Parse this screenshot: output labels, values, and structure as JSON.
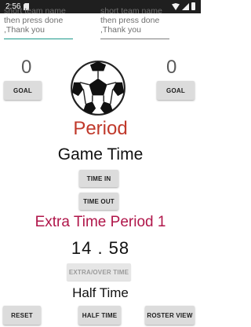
{
  "status_bar": {
    "time": "2:56",
    "icons": [
      "sd-card-icon",
      "wifi-icon",
      "signal-icon",
      "battery-icon"
    ]
  },
  "team_inputs": {
    "left_text": "short team name\nthen press done\n,Thank you",
    "right_text": "short team name\nthen press done\n,Thank you"
  },
  "scores": {
    "left": "0",
    "right": "0"
  },
  "buttons": {
    "goal_left": "GOAL",
    "goal_right": "GOAL",
    "time_in": "TIME IN",
    "time_out": "TIME OUT",
    "extra_over_time": "EXTRA/OVER TIME",
    "reset": "RESET",
    "half_time": "HALF TIME",
    "roster_view": "ROSTER VIEW"
  },
  "labels": {
    "period": "Period",
    "game_time": "Game Time",
    "extra_time_period": "Extra Time Period 1",
    "timer": "14 . 58",
    "half_time": "Half Time"
  },
  "colors": {
    "period": "#c0392b",
    "extra_period": "#b0164a",
    "button_bg": "#dcdcdc",
    "input_focus_underline": "#1c9a8a"
  }
}
